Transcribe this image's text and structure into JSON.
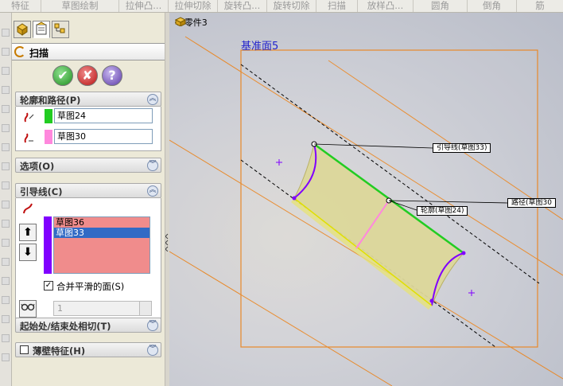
{
  "toolbar": {
    "items": [
      "特征",
      "草图绘制",
      "拉伸凸...",
      "拉伸切除",
      "旋转凸...",
      "旋转切除",
      "扫描",
      "放样凸...",
      "圆角",
      "倒角",
      "筋"
    ]
  },
  "tabs": [
    "feature-manager",
    "property-manager",
    "configuration-manager"
  ],
  "feature": {
    "title": "扫描",
    "ok": "✔",
    "cancel": "✘",
    "help": "?"
  },
  "sections": {
    "profile_path": {
      "title": "轮廓和路径(P)",
      "profile": "草图24",
      "path": "草图30"
    },
    "options": {
      "title": "选项(O)"
    },
    "guides": {
      "title": "引导线(C)",
      "items": [
        "草图36",
        "草图33"
      ],
      "selected_index": 1,
      "merge_label": "合并平滑的面(S)",
      "merge_checked": true,
      "spin_value": "1"
    },
    "tangency": {
      "title": "起始处/结束处相切(T)"
    },
    "thin": {
      "title": "薄壁特征(H)",
      "checked": false
    }
  },
  "viewport": {
    "tree_label": "零件3",
    "plane_label": "基准面5",
    "callouts": {
      "guide": "引导线(草图33)",
      "profile": "轮廓(草图24)",
      "path": "路径(草图30"
    }
  },
  "colors": {
    "accent_green": "#22cc22",
    "profile_pink": "#ff88dd",
    "guide_purple": "#8000ff",
    "list_red": "#f08c8c"
  }
}
